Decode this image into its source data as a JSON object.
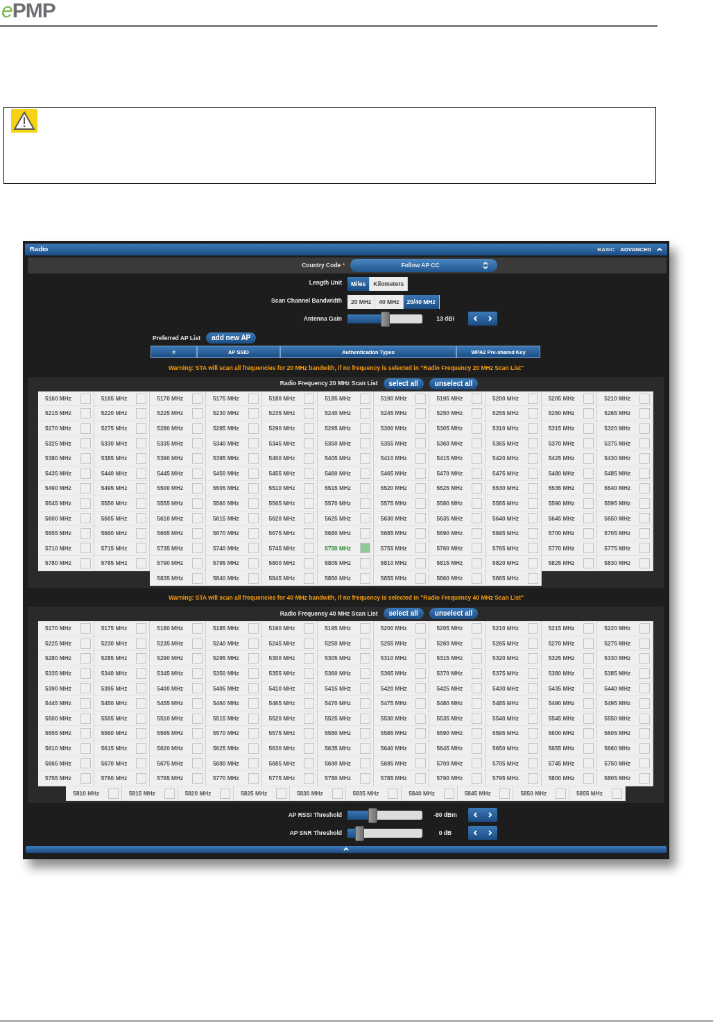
{
  "header": {
    "logo": {
      "prefix": "e",
      "name": "PMP"
    }
  },
  "panel": {
    "title": "Radio",
    "modes": [
      {
        "label": "BASIC",
        "selected": false
      },
      {
        "label": "ADVANCED",
        "selected": true
      }
    ]
  },
  "country_code": {
    "label": "Country Code",
    "required_mark": "*",
    "value": "Follow AP CC"
  },
  "length_unit": {
    "label": "Length Unit",
    "options": [
      {
        "label": "Miles",
        "selected": true
      },
      {
        "label": "Kilometers",
        "selected": false
      }
    ]
  },
  "scan_channel_bandwidth": {
    "label": "Scan Channel Bandwidth",
    "options": [
      {
        "label": "20 MHz",
        "selected": false
      },
      {
        "label": "40 MHz",
        "selected": false
      },
      {
        "label": "20/40 MHz",
        "selected": true
      }
    ]
  },
  "antenna_gain": {
    "label": "Antenna Gain",
    "level": 0.44,
    "reading": "13 dBi"
  },
  "preferred_ap_list": {
    "label": "Preferred AP List",
    "button": "add new AP",
    "columns": [
      "#",
      "AP SSID",
      "Authentication Types",
      "WPA2 Pre-shared Key"
    ]
  },
  "scan_lists": [
    {
      "warning": "Warning: STA will scan all frequencies for 20 MHz bandwith, if no frequency is selected in \"Radio Frequency 20 MHz Scan List\"",
      "title": "Radio Frequency 20 MHz Scan List",
      "buttons": [
        "select all",
        "unselect all"
      ],
      "channels": [
        {
          "label": "5160 MHz",
          "checked": false
        },
        {
          "label": "5165 MHz",
          "checked": false
        },
        {
          "label": "5170 MHz",
          "checked": false
        },
        {
          "label": "5175 MHz",
          "checked": false
        },
        {
          "label": "5180 MHz",
          "checked": false
        },
        {
          "label": "5185 MHz",
          "checked": false
        },
        {
          "label": "5190 MHz",
          "checked": false
        },
        {
          "label": "5195 MHz",
          "checked": false
        },
        {
          "label": "5200 MHz",
          "checked": false
        },
        {
          "label": "5205 MHz",
          "checked": false
        },
        {
          "label": "5210 MHz",
          "checked": false
        },
        {
          "label": "5215 MHz",
          "checked": false
        },
        {
          "label": "5220 MHz",
          "checked": false
        },
        {
          "label": "5225 MHz",
          "checked": false
        },
        {
          "label": "5230 MHz",
          "checked": false
        },
        {
          "label": "5235 MHz",
          "checked": false
        },
        {
          "label": "5240 MHz",
          "checked": false
        },
        {
          "label": "5245 MHz",
          "checked": false
        },
        {
          "label": "5250 MHz",
          "checked": false
        },
        {
          "label": "5255 MHz",
          "checked": false
        },
        {
          "label": "5260 MHz",
          "checked": false
        },
        {
          "label": "5265 MHz",
          "checked": false
        },
        {
          "label": "5270 MHz",
          "checked": false
        },
        {
          "label": "5275 MHz",
          "checked": false
        },
        {
          "label": "5280 MHz",
          "checked": false
        },
        {
          "label": "5285 MHz",
          "checked": false
        },
        {
          "label": "5290 MHz",
          "checked": false
        },
        {
          "label": "5295 MHz",
          "checked": false
        },
        {
          "label": "5300 MHz",
          "checked": false
        },
        {
          "label": "5305 MHz",
          "checked": false
        },
        {
          "label": "5310 MHz",
          "checked": false
        },
        {
          "label": "5315 MHz",
          "checked": false
        },
        {
          "label": "5320 MHz",
          "checked": false
        },
        {
          "label": "5325 MHz",
          "checked": false
        },
        {
          "label": "5330 MHz",
          "checked": false
        },
        {
          "label": "5335 MHz",
          "checked": false
        },
        {
          "label": "5340 MHz",
          "checked": false
        },
        {
          "label": "5345 MHz",
          "checked": false
        },
        {
          "label": "5350 MHz",
          "checked": false
        },
        {
          "label": "5355 MHz",
          "checked": false
        },
        {
          "label": "5360 MHz",
          "checked": false
        },
        {
          "label": "5365 MHz",
          "checked": false
        },
        {
          "label": "5370 MHz",
          "checked": false
        },
        {
          "label": "5375 MHz",
          "checked": false
        },
        {
          "label": "5380 MHz",
          "checked": false
        },
        {
          "label": "5385 MHz",
          "checked": false
        },
        {
          "label": "5390 MHz",
          "checked": false
        },
        {
          "label": "5395 MHz",
          "checked": false
        },
        {
          "label": "5400 MHz",
          "checked": false
        },
        {
          "label": "5405 MHz",
          "checked": false
        },
        {
          "label": "5410 MHz",
          "checked": false
        },
        {
          "label": "5415 MHz",
          "checked": false
        },
        {
          "label": "5420 MHz",
          "checked": false
        },
        {
          "label": "5425 MHz",
          "checked": false
        },
        {
          "label": "5430 MHz",
          "checked": false
        },
        {
          "label": "5435 MHz",
          "checked": false
        },
        {
          "label": "5440 MHz",
          "checked": false
        },
        {
          "label": "5445 MHz",
          "checked": false
        },
        {
          "label": "5450 MHz",
          "checked": false
        },
        {
          "label": "5455 MHz",
          "checked": false
        },
        {
          "label": "5460 MHz",
          "checked": false
        },
        {
          "label": "5465 MHz",
          "checked": false
        },
        {
          "label": "5470 MHz",
          "checked": false
        },
        {
          "label": "5475 MHz",
          "checked": false
        },
        {
          "label": "5480 MHz",
          "checked": false
        },
        {
          "label": "5485 MHz",
          "checked": false
        },
        {
          "label": "5490 MHz",
          "checked": false
        },
        {
          "label": "5495 MHz",
          "checked": false
        },
        {
          "label": "5500 MHz",
          "checked": false
        },
        {
          "label": "5505 MHz",
          "checked": false
        },
        {
          "label": "5510 MHz",
          "checked": false
        },
        {
          "label": "5515 MHz",
          "checked": false
        },
        {
          "label": "5520 MHz",
          "checked": false
        },
        {
          "label": "5525 MHz",
          "checked": false
        },
        {
          "label": "5530 MHz",
          "checked": false
        },
        {
          "label": "5535 MHz",
          "checked": false
        },
        {
          "label": "5540 MHz",
          "checked": false
        },
        {
          "label": "5545 MHz",
          "checked": false
        },
        {
          "label": "5550 MHz",
          "checked": false
        },
        {
          "label": "5555 MHz",
          "checked": false
        },
        {
          "label": "5560 MHz",
          "checked": false
        },
        {
          "label": "5565 MHz",
          "checked": false
        },
        {
          "label": "5570 MHz",
          "checked": false
        },
        {
          "label": "5575 MHz",
          "checked": false
        },
        {
          "label": "5580 MHz",
          "checked": false
        },
        {
          "label": "5585 MHz",
          "checked": false
        },
        {
          "label": "5590 MHz",
          "checked": false
        },
        {
          "label": "5595 MHz",
          "checked": false
        },
        {
          "label": "5600 MHz",
          "checked": false
        },
        {
          "label": "5605 MHz",
          "checked": false
        },
        {
          "label": "5610 MHz",
          "checked": false
        },
        {
          "label": "5615 MHz",
          "checked": false
        },
        {
          "label": "5620 MHz",
          "checked": false
        },
        {
          "label": "5625 MHz",
          "checked": false
        },
        {
          "label": "5630 MHz",
          "checked": false
        },
        {
          "label": "5635 MHz",
          "checked": false
        },
        {
          "label": "5640 MHz",
          "checked": false
        },
        {
          "label": "5645 MHz",
          "checked": false
        },
        {
          "label": "5650 MHz",
          "checked": false
        },
        {
          "label": "5655 MHz",
          "checked": false
        },
        {
          "label": "5660 MHz",
          "checked": false
        },
        {
          "label": "5665 MHz",
          "checked": false
        },
        {
          "label": "5670 MHz",
          "checked": false
        },
        {
          "label": "5675 MHz",
          "checked": false
        },
        {
          "label": "5680 MHz",
          "checked": false
        },
        {
          "label": "5685 MHz",
          "checked": false
        },
        {
          "label": "5690 MHz",
          "checked": false
        },
        {
          "label": "5695 MHz",
          "checked": false
        },
        {
          "label": "5700 MHz",
          "checked": false
        },
        {
          "label": "5705 MHz",
          "checked": false
        },
        {
          "label": "5710 MHz",
          "checked": false
        },
        {
          "label": "5715 MHz",
          "checked": false
        },
        {
          "label": "5735 MHz",
          "checked": false
        },
        {
          "label": "5740 MHz",
          "checked": false
        },
        {
          "label": "5745 MHz",
          "checked": false
        },
        {
          "label": "5750 MHz",
          "checked": true
        },
        {
          "label": "5755 MHz",
          "checked": false
        },
        {
          "label": "5760 MHz",
          "checked": false
        },
        {
          "label": "5765 MHz",
          "checked": false
        },
        {
          "label": "5770 MHz",
          "checked": false
        },
        {
          "label": "5775 MHz",
          "checked": false
        },
        {
          "label": "5780 MHz",
          "checked": false
        },
        {
          "label": "5785 MHz",
          "checked": false
        },
        {
          "label": "5790 MHz",
          "checked": false
        },
        {
          "label": "5795 MHz",
          "checked": false
        },
        {
          "label": "5800 MHz",
          "checked": false
        },
        {
          "label": "5805 MHz",
          "checked": false
        },
        {
          "label": "5810 MHz",
          "checked": false
        },
        {
          "label": "5815 MHz",
          "checked": false
        },
        {
          "label": "5820 MHz",
          "checked": false
        },
        {
          "label": "5825 MHz",
          "checked": false
        },
        {
          "label": "5830 MHz",
          "checked": false
        },
        {
          "label": "5835 MHz",
          "checked": false
        },
        {
          "label": "5840 MHz",
          "checked": false
        },
        {
          "label": "5845 MHz",
          "checked": false
        },
        {
          "label": "5850 MHz",
          "checked": false
        },
        {
          "label": "5855 MHz",
          "checked": false
        },
        {
          "label": "5860 MHz",
          "checked": false
        },
        {
          "label": "5865 MHz",
          "checked": false
        }
      ]
    },
    {
      "warning": "Warning: STA will scan all frequencies for 40 MHz bandwith, if no frequency is selected in \"Radio Frequency 40 MHz Scan List\"",
      "title": "Radio Frequency 40 MHz Scan List",
      "buttons": [
        "select all",
        "unselect all"
      ],
      "channels": [
        {
          "label": "5170 MHz",
          "checked": false
        },
        {
          "label": "5175 MHz",
          "checked": false
        },
        {
          "label": "5180 MHz",
          "checked": false
        },
        {
          "label": "5185 MHz",
          "checked": false
        },
        {
          "label": "5190 MHz",
          "checked": false
        },
        {
          "label": "5195 MHz",
          "checked": false
        },
        {
          "label": "5200 MHz",
          "checked": false
        },
        {
          "label": "5205 MHz",
          "checked": false
        },
        {
          "label": "5210 MHz",
          "checked": false
        },
        {
          "label": "5215 MHz",
          "checked": false
        },
        {
          "label": "5220 MHz",
          "checked": false
        },
        {
          "label": "5225 MHz",
          "checked": false
        },
        {
          "label": "5230 MHz",
          "checked": false
        },
        {
          "label": "5235 MHz",
          "checked": false
        },
        {
          "label": "5240 MHz",
          "checked": false
        },
        {
          "label": "5245 MHz",
          "checked": false
        },
        {
          "label": "5250 MHz",
          "checked": false
        },
        {
          "label": "5255 MHz",
          "checked": false
        },
        {
          "label": "5260 MHz",
          "checked": false
        },
        {
          "label": "5265 MHz",
          "checked": false
        },
        {
          "label": "5270 MHz",
          "checked": false
        },
        {
          "label": "5275 MHz",
          "checked": false
        },
        {
          "label": "5280 MHz",
          "checked": false
        },
        {
          "label": "5285 MHz",
          "checked": false
        },
        {
          "label": "5290 MHz",
          "checked": false
        },
        {
          "label": "5295 MHz",
          "checked": false
        },
        {
          "label": "5300 MHz",
          "checked": false
        },
        {
          "label": "5305 MHz",
          "checked": false
        },
        {
          "label": "5310 MHz",
          "checked": false
        },
        {
          "label": "5315 MHz",
          "checked": false
        },
        {
          "label": "5320 MHz",
          "checked": false
        },
        {
          "label": "5325 MHz",
          "checked": false
        },
        {
          "label": "5330 MHz",
          "checked": false
        },
        {
          "label": "5335 MHz",
          "checked": false
        },
        {
          "label": "5340 MHz",
          "checked": false
        },
        {
          "label": "5345 MHz",
          "checked": false
        },
        {
          "label": "5350 MHz",
          "checked": false
        },
        {
          "label": "5355 MHz",
          "checked": false
        },
        {
          "label": "5360 MHz",
          "checked": false
        },
        {
          "label": "5365 MHz",
          "checked": false
        },
        {
          "label": "5370 MHz",
          "checked": false
        },
        {
          "label": "5375 MHz",
          "checked": false
        },
        {
          "label": "5380 MHz",
          "checked": false
        },
        {
          "label": "5385 MHz",
          "checked": false
        },
        {
          "label": "5390 MHz",
          "checked": false
        },
        {
          "label": "5395 MHz",
          "checked": false
        },
        {
          "label": "5400 MHz",
          "checked": false
        },
        {
          "label": "5405 MHz",
          "checked": false
        },
        {
          "label": "5410 MHz",
          "checked": false
        },
        {
          "label": "5415 MHz",
          "checked": false
        },
        {
          "label": "5420 MHz",
          "checked": false
        },
        {
          "label": "5425 MHz",
          "checked": false
        },
        {
          "label": "5430 MHz",
          "checked": false
        },
        {
          "label": "5435 MHz",
          "checked": false
        },
        {
          "label": "5440 MHz",
          "checked": false
        },
        {
          "label": "5445 MHz",
          "checked": false
        },
        {
          "label": "5450 MHz",
          "checked": false
        },
        {
          "label": "5455 MHz",
          "checked": false
        },
        {
          "label": "5460 MHz",
          "checked": false
        },
        {
          "label": "5465 MHz",
          "checked": false
        },
        {
          "label": "5470 MHz",
          "checked": false
        },
        {
          "label": "5475 MHz",
          "checked": false
        },
        {
          "label": "5480 MHz",
          "checked": false
        },
        {
          "label": "5485 MHz",
          "checked": false
        },
        {
          "label": "5490 MHz",
          "checked": false
        },
        {
          "label": "5495 MHz",
          "checked": false
        },
        {
          "label": "5500 MHz",
          "checked": false
        },
        {
          "label": "5505 MHz",
          "checked": false
        },
        {
          "label": "5510 MHz",
          "checked": false
        },
        {
          "label": "5515 MHz",
          "checked": false
        },
        {
          "label": "5520 MHz",
          "checked": false
        },
        {
          "label": "5525 MHz",
          "checked": false
        },
        {
          "label": "5530 MHz",
          "checked": false
        },
        {
          "label": "5535 MHz",
          "checked": false
        },
        {
          "label": "5540 MHz",
          "checked": false
        },
        {
          "label": "5545 MHz",
          "checked": false
        },
        {
          "label": "5550 MHz",
          "checked": false
        },
        {
          "label": "5555 MHz",
          "checked": false
        },
        {
          "label": "5560 MHz",
          "checked": false
        },
        {
          "label": "5565 MHz",
          "checked": false
        },
        {
          "label": "5570 MHz",
          "checked": false
        },
        {
          "label": "5575 MHz",
          "checked": false
        },
        {
          "label": "5580 MHz",
          "checked": false
        },
        {
          "label": "5585 MHz",
          "checked": false
        },
        {
          "label": "5590 MHz",
          "checked": false
        },
        {
          "label": "5595 MHz",
          "checked": false
        },
        {
          "label": "5600 MHz",
          "checked": false
        },
        {
          "label": "5605 MHz",
          "checked": false
        },
        {
          "label": "5610 MHz",
          "checked": false
        },
        {
          "label": "5615 MHz",
          "checked": false
        },
        {
          "label": "5620 MHz",
          "checked": false
        },
        {
          "label": "5625 MHz",
          "checked": false
        },
        {
          "label": "5630 MHz",
          "checked": false
        },
        {
          "label": "5635 MHz",
          "checked": false
        },
        {
          "label": "5640 MHz",
          "checked": false
        },
        {
          "label": "5645 MHz",
          "checked": false
        },
        {
          "label": "5650 MHz",
          "checked": false
        },
        {
          "label": "5655 MHz",
          "checked": false
        },
        {
          "label": "5660 MHz",
          "checked": false
        },
        {
          "label": "5665 MHz",
          "checked": false
        },
        {
          "label": "5670 MHz",
          "checked": false
        },
        {
          "label": "5675 MHz",
          "checked": false
        },
        {
          "label": "5680 MHz",
          "checked": false
        },
        {
          "label": "5685 MHz",
          "checked": false
        },
        {
          "label": "5690 MHz",
          "checked": false
        },
        {
          "label": "5695 MHz",
          "checked": false
        },
        {
          "label": "5700 MHz",
          "checked": false
        },
        {
          "label": "5705 MHz",
          "checked": false
        },
        {
          "label": "5745 MHz",
          "checked": false
        },
        {
          "label": "5750 MHz",
          "checked": false
        },
        {
          "label": "5755 MHz",
          "checked": false
        },
        {
          "label": "5760 MHz",
          "checked": false
        },
        {
          "label": "5765 MHz",
          "checked": false
        },
        {
          "label": "5770 MHz",
          "checked": false
        },
        {
          "label": "5775 MHz",
          "checked": false
        },
        {
          "label": "5780 MHz",
          "checked": false
        },
        {
          "label": "5785 MHz",
          "checked": false
        },
        {
          "label": "5790 MHz",
          "checked": false
        },
        {
          "label": "5795 MHz",
          "checked": false
        },
        {
          "label": "5800 MHz",
          "checked": false
        },
        {
          "label": "5805 MHz",
          "checked": false
        },
        {
          "label": "5810 MHz",
          "checked": false
        },
        {
          "label": "5815 MHz",
          "checked": false
        },
        {
          "label": "5820 MHz",
          "checked": false
        },
        {
          "label": "5825 MHz",
          "checked": false
        },
        {
          "label": "5830 MHz",
          "checked": false
        },
        {
          "label": "5835 MHz",
          "checked": false
        },
        {
          "label": "5840 MHz",
          "checked": false
        },
        {
          "label": "5845 MHz",
          "checked": false
        },
        {
          "label": "5850 MHz",
          "checked": false
        },
        {
          "label": "5855 MHz",
          "checked": false
        }
      ]
    }
  ],
  "rssi_threshold": {
    "label": "AP RSSI Threshold",
    "level": 0.28,
    "reading": "-80 dBm"
  },
  "snr_threshold": {
    "label": "AP SNR Threshold",
    "level": 0.1,
    "reading": "0 dB"
  }
}
